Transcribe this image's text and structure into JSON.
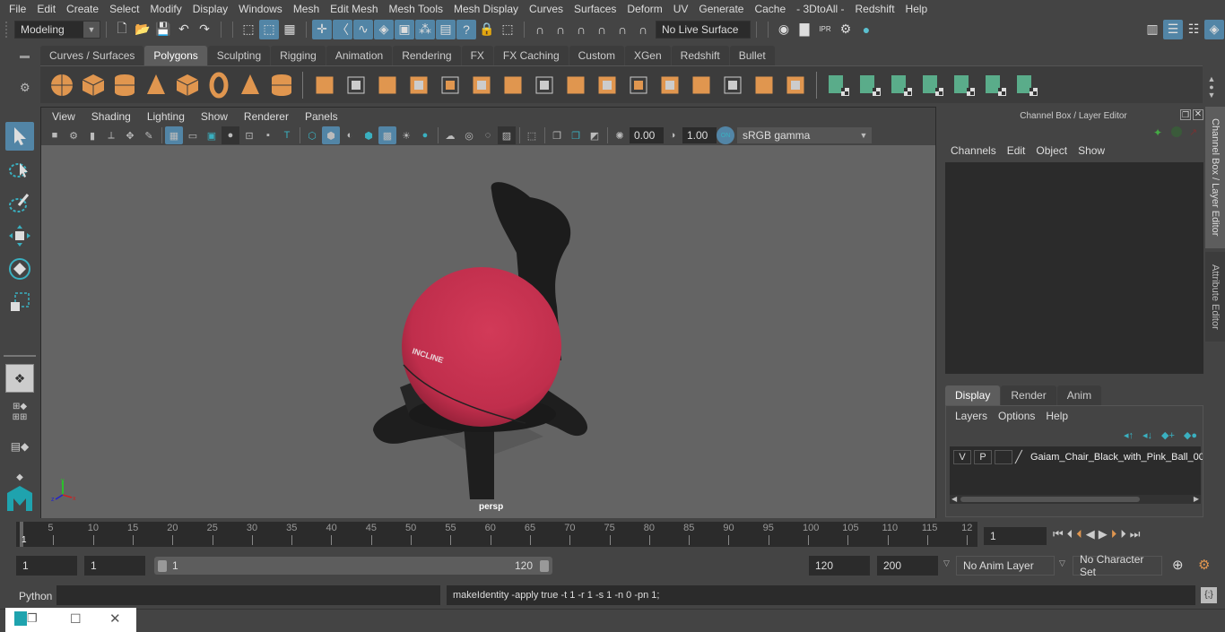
{
  "menu": [
    "File",
    "Edit",
    "Create",
    "Select",
    "Modify",
    "Display",
    "Windows",
    "Mesh",
    "Edit Mesh",
    "Mesh Tools",
    "Mesh Display",
    "Curves",
    "Surfaces",
    "Deform",
    "UV",
    "Generate",
    "Cache",
    "- 3DtoAll -",
    "Redshift",
    "Help"
  ],
  "status_line": {
    "mode_dropdown": "Modeling",
    "live_surface": "No Live Surface"
  },
  "shelf": {
    "tabs": [
      "Curves / Surfaces",
      "Polygons",
      "Sculpting",
      "Rigging",
      "Animation",
      "Rendering",
      "FX",
      "FX Caching",
      "Custom",
      "XGen",
      "Redshift",
      "Bullet"
    ],
    "active_tab": "Polygons",
    "icons": [
      "poly-sphere",
      "poly-cube",
      "poly-cylinder",
      "poly-cone",
      "poly-plane",
      "poly-torus",
      "poly-pyramid",
      "poly-pipe",
      "combine",
      "separate",
      "mirror",
      "smooth",
      "extract",
      "boolean",
      "multi-cut",
      "extrude",
      "bridge",
      "bevel",
      "insert-edge-loop",
      "append-polygon",
      "offset-edge-loop",
      "fill-hole",
      "edge-loop",
      "target-weld",
      "uv-planar",
      "uv-cylindrical",
      "uv-spherical",
      "uv-automatic",
      "uv-unfold",
      "uv-editor",
      "uv-layout"
    ]
  },
  "viewport": {
    "menu": [
      "View",
      "Shading",
      "Lighting",
      "Show",
      "Renderer",
      "Panels"
    ],
    "exposure": "0.00",
    "gamma": "1.00",
    "color_mgmt_toggle": "ON",
    "color_space": "sRGB gamma",
    "camera_label": "persp",
    "ball_label": "INCLINE",
    "axis": {
      "x": "x",
      "y": "y",
      "z": "z"
    }
  },
  "channel_box": {
    "title": "Channel Box / Layer Editor",
    "menu": [
      "Channels",
      "Edit",
      "Object",
      "Show"
    ]
  },
  "layer_editor": {
    "tabs": [
      "Display",
      "Render",
      "Anim"
    ],
    "active_tab": "Display",
    "menu": [
      "Layers",
      "Options",
      "Help"
    ],
    "layers": [
      {
        "visible": "V",
        "playback": "P",
        "name": "Gaiam_Chair_Black_with_Pink_Ball_00"
      }
    ]
  },
  "side_tabs": [
    "Channel Box / Layer Editor",
    "Attribute Editor"
  ],
  "timeline": {
    "ticks": [
      "5",
      "10",
      "15",
      "20",
      "25",
      "30",
      "35",
      "40",
      "45",
      "50",
      "55",
      "60",
      "65",
      "70",
      "75",
      "80",
      "85",
      "90",
      "95",
      "100",
      "105",
      "110",
      "115",
      "12"
    ],
    "current_frame_marker": "1",
    "current_frame": "1"
  },
  "range": {
    "start": "1",
    "playback_start": "1",
    "slider_start": "1",
    "slider_end": "120",
    "playback_end": "120",
    "end": "200",
    "anim_layer": "No Anim Layer",
    "character_set": "No Character Set"
  },
  "command_line": {
    "language": "Python",
    "input": "",
    "result": "makeIdentity -apply true -t 1 -r 1 -s 1 -n 0 -pn 1;"
  },
  "colors": {
    "accent": "#5285a6",
    "shelf_orange": "#e0964f",
    "shelf_green": "#5aac8a",
    "ball": "#c83250",
    "viewport_bg": "#646464"
  }
}
